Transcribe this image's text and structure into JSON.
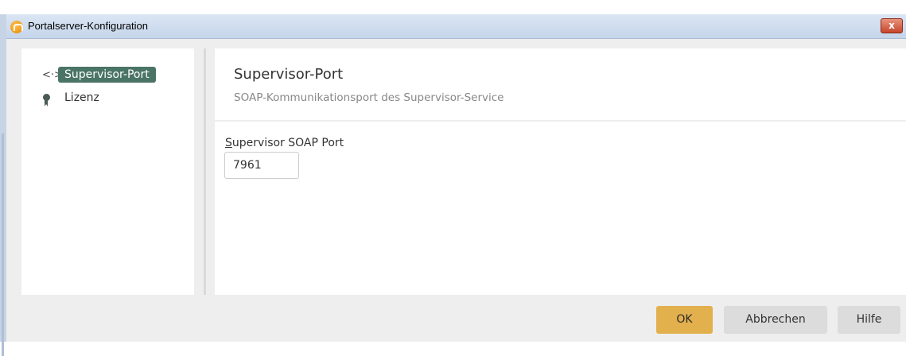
{
  "window": {
    "title": "Portalserver-Konfiguration",
    "close_glyph": "x"
  },
  "nav": {
    "items": [
      {
        "label": "Supervisor-Port",
        "icon": "bidirectional-arrow-icon",
        "icon_glyph": "<·>",
        "selected": true
      },
      {
        "label": "Lizenz",
        "icon": "award-ribbon-icon",
        "selected": false
      }
    ]
  },
  "header": {
    "title": "Supervisor-Port",
    "subtitle": "SOAP-Kommunikationsport des Supervisor-Service"
  },
  "form": {
    "port_label_mnemonic": "S",
    "port_label_rest": "upervisor SOAP Port",
    "port_value": "7961"
  },
  "buttons": {
    "ok": "OK",
    "cancel": "Abbrechen",
    "help": "Hilfe"
  },
  "colors": {
    "selected_nav": "#4a7466",
    "ok_button": "#e3b04e",
    "secondary_button": "#dcdcdc",
    "close_button": "#c7452c"
  }
}
